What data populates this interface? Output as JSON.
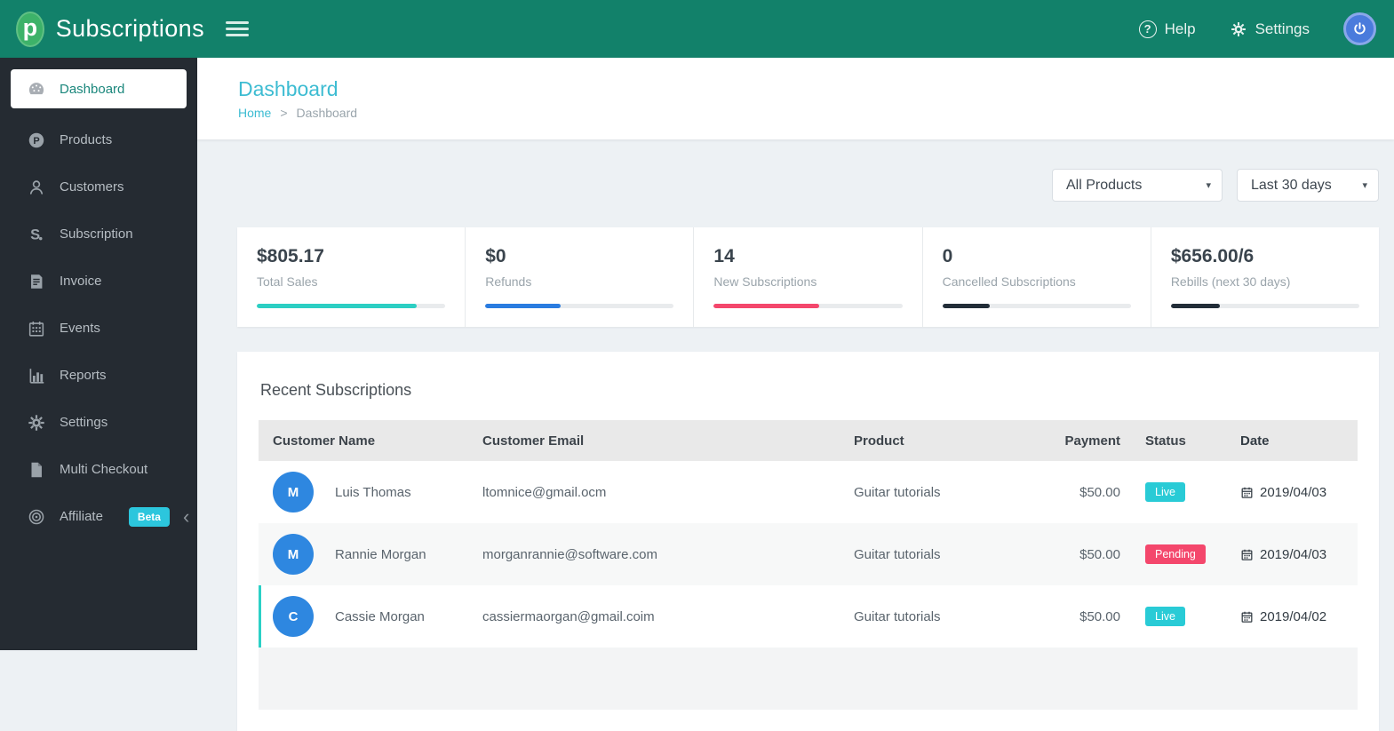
{
  "topbar": {
    "brand": "Subscriptions",
    "logo_letter": "p",
    "nav": {
      "help": "Help",
      "settings": "Settings"
    }
  },
  "sidebar": {
    "items": [
      {
        "label": "Dashboard"
      },
      {
        "label": "Products"
      },
      {
        "label": "Customers"
      },
      {
        "label": "Subscription"
      },
      {
        "label": "Invoice"
      },
      {
        "label": "Events"
      },
      {
        "label": "Reports"
      },
      {
        "label": "Settings"
      },
      {
        "label": "Multi Checkout"
      },
      {
        "label": "Affiliate",
        "badge": "Beta"
      }
    ]
  },
  "page": {
    "title": "Dashboard",
    "breadcrumb": {
      "home": "Home",
      "separator": ">",
      "current": "Dashboard"
    }
  },
  "filters": {
    "product": "All Products",
    "range": "Last 30 days"
  },
  "stats": [
    {
      "value": "$805.17",
      "label": "Total Sales",
      "progress": {
        "pct": 85,
        "color": "#2ccfc3"
      }
    },
    {
      "value": "$0",
      "label": "Refunds",
      "progress": {
        "pct": 40,
        "color": "#2a7ce0"
      }
    },
    {
      "value": "14",
      "label": "New Subscriptions",
      "progress": {
        "pct": 56,
        "color": "#f4476c"
      }
    },
    {
      "value": "0",
      "label": "Cancelled Subscriptions",
      "progress": {
        "pct": 25,
        "color": "#222d38"
      }
    },
    {
      "value": "$656.00/6",
      "label": "Rebills (next 30 days)",
      "progress": {
        "pct": 26,
        "color": "#222d38"
      }
    }
  ],
  "recent": {
    "title": "Recent Subscriptions",
    "columns": {
      "name": "Customer Name",
      "email": "Customer Email",
      "product": "Product",
      "payment": "Payment",
      "status": "Status",
      "date": "Date"
    },
    "rows": [
      {
        "avatar": {
          "letter": "M",
          "color": "#2e87e0"
        },
        "name": "Luis Thomas",
        "email": "ltomnice@gmail.ocm",
        "product": "Guitar tutorials",
        "payment": "$50.00",
        "status": {
          "label": "Live",
          "color": "#29cbd6"
        },
        "date": "2019/04/03"
      },
      {
        "avatar": {
          "letter": "M",
          "color": "#2e87e0"
        },
        "name": "Rannie Morgan",
        "email": "morganrannie@software.com",
        "product": "Guitar tutorials",
        "payment": "$50.00",
        "status": {
          "label": "Pending",
          "color": "#f4476c"
        },
        "date": "2019/04/03"
      },
      {
        "avatar": {
          "letter": "C",
          "color": "#2e87e0"
        },
        "name": "Cassie Morgan",
        "email": "cassiermaorgan@gmail.coim",
        "product": "Guitar tutorials",
        "payment": "$50.00",
        "status": {
          "label": "Live",
          "color": "#29cbd6"
        },
        "date": "2019/04/02"
      }
    ]
  },
  "colors": {
    "topbar_bg": "#12816a",
    "sidebar_bg": "#252b32",
    "beta_badge": "#2cc6dd",
    "title_cyan": "#3dbcd2",
    "active_row_accent": "#2bd0c6",
    "content_bg": "#edf1f4"
  }
}
